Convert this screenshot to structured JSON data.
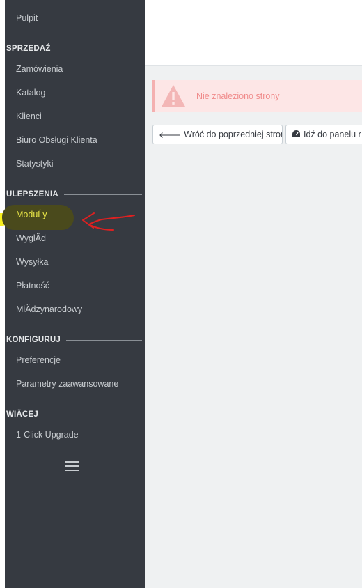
{
  "sidebar": {
    "top_item": "Pulpit",
    "sections": [
      {
        "title": "SPRZEDAŹ",
        "items": [
          "Zamówienia",
          "Katalog",
          "Klienci",
          "Biuro Obsługi Klienta",
          "Statystyki"
        ]
      },
      {
        "title": "ULEPSZENIA",
        "items": [
          "ModuĹy",
          "WyglÄd",
          "Wysyłka",
          "Płatność",
          "MiÄdzynarodowy"
        ]
      },
      {
        "title": "KONFIGURUJ",
        "items": [
          "Preferencje",
          "Parametry zaawansowane"
        ]
      },
      {
        "title": "WIÄCEJ",
        "items": [
          "1-Click Upgrade"
        ]
      }
    ],
    "active_item": "ModuĹy",
    "menu_icon": "hamburger-icon"
  },
  "main": {
    "alert": {
      "icon": "warning-triangle-icon",
      "text": "Nie znaleziono strony"
    },
    "buttons": [
      {
        "icon": "arrow-left-icon",
        "label": "Wróć do poprzedniej strony"
      },
      {
        "icon": "dashboard-icon",
        "label": "Idź do panelu r"
      }
    ]
  },
  "colors": {
    "sidebar_bg": "#363a41",
    "active_text": "#e7e447",
    "alert_bg": "#fde6e6",
    "alert_text": "#f08b8b",
    "content_bg": "#eff1f2",
    "annotation_arrow": "#e02020"
  }
}
